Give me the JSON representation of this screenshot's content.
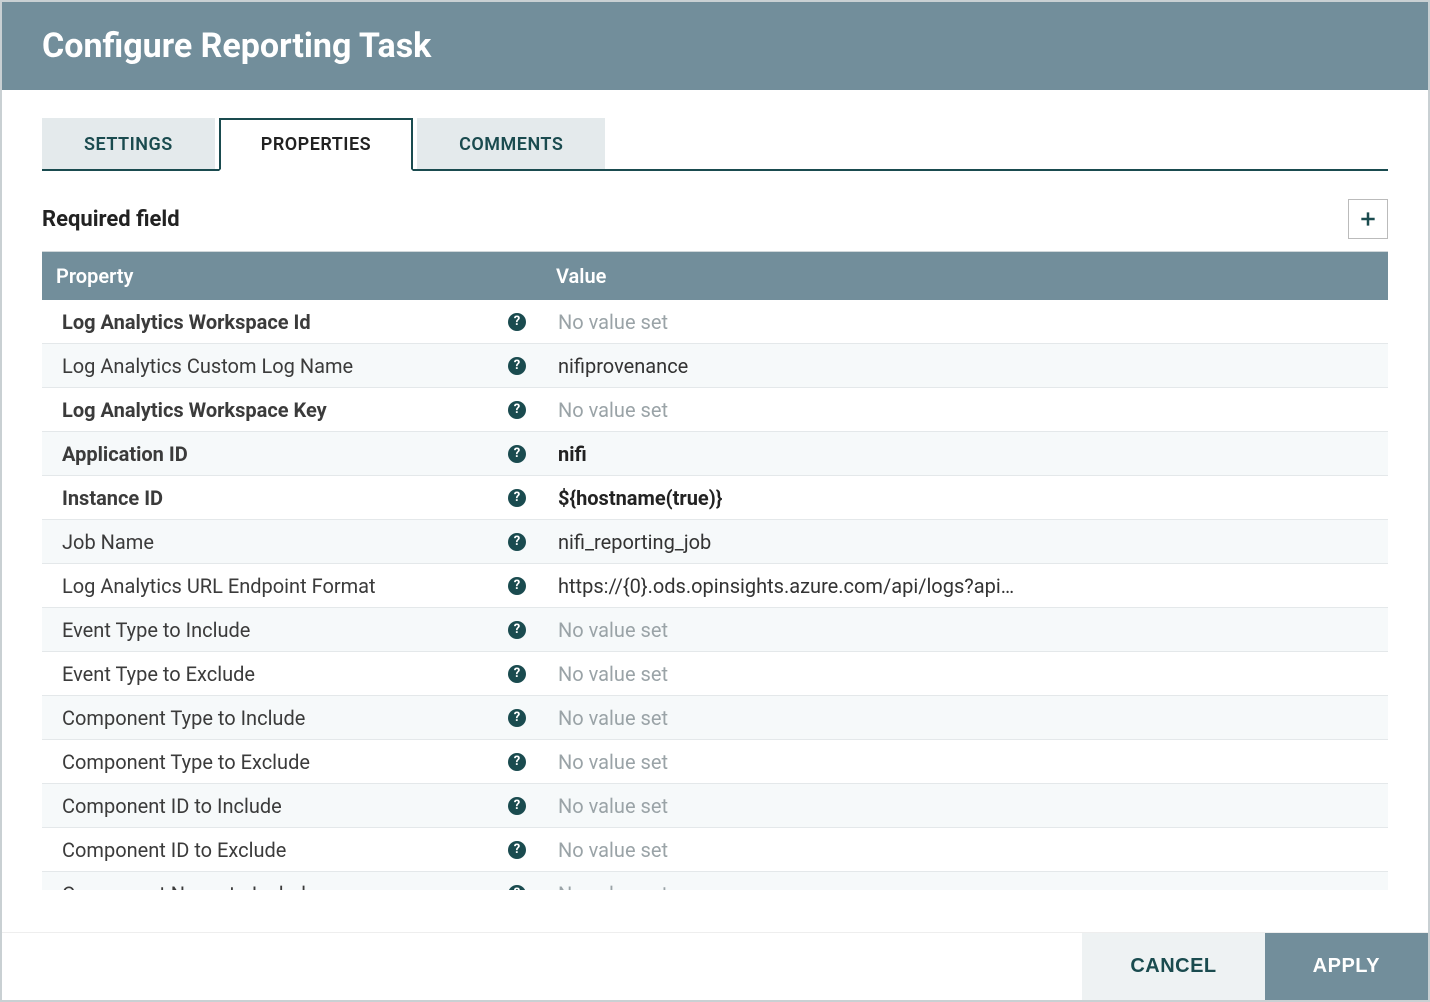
{
  "header": {
    "title": "Configure Reporting Task"
  },
  "tabs": [
    {
      "id": "settings",
      "label": "SETTINGS",
      "active": false
    },
    {
      "id": "properties",
      "label": "PROPERTIES",
      "active": true
    },
    {
      "id": "comments",
      "label": "COMMENTS",
      "active": false
    }
  ],
  "section": {
    "required_field_heading": "Required field"
  },
  "table": {
    "headers": {
      "property": "Property",
      "value": "Value"
    },
    "rows": [
      {
        "name": "Log Analytics Workspace Id",
        "required": true,
        "value": "",
        "placeholder": "No value set",
        "bold": false
      },
      {
        "name": "Log Analytics Custom Log Name",
        "required": false,
        "value": "nifiprovenance",
        "placeholder": "No value set",
        "bold": false
      },
      {
        "name": "Log Analytics Workspace Key",
        "required": true,
        "value": "",
        "placeholder": "No value set",
        "bold": false
      },
      {
        "name": "Application ID",
        "required": true,
        "value": "nifi",
        "placeholder": "No value set",
        "bold": true
      },
      {
        "name": "Instance ID",
        "required": true,
        "value": "${hostname(true)}",
        "placeholder": "No value set",
        "bold": true
      },
      {
        "name": "Job Name",
        "required": false,
        "value": "nifi_reporting_job",
        "placeholder": "No value set",
        "bold": false
      },
      {
        "name": "Log Analytics URL Endpoint Format",
        "required": false,
        "value": "https://{0}.ods.opinsights.azure.com/api/logs?api…",
        "placeholder": "No value set",
        "bold": false
      },
      {
        "name": "Event Type to Include",
        "required": false,
        "value": "",
        "placeholder": "No value set",
        "bold": false
      },
      {
        "name": "Event Type to Exclude",
        "required": false,
        "value": "",
        "placeholder": "No value set",
        "bold": false
      },
      {
        "name": "Component Type to Include",
        "required": false,
        "value": "",
        "placeholder": "No value set",
        "bold": false
      },
      {
        "name": "Component Type to Exclude",
        "required": false,
        "value": "",
        "placeholder": "No value set",
        "bold": false
      },
      {
        "name": "Component ID to Include",
        "required": false,
        "value": "",
        "placeholder": "No value set",
        "bold": false
      },
      {
        "name": "Component ID to Exclude",
        "required": false,
        "value": "",
        "placeholder": "No value set",
        "bold": false
      },
      {
        "name": "Component Name to Include",
        "required": false,
        "value": "",
        "placeholder": "No value set",
        "bold": false
      }
    ]
  },
  "footer": {
    "cancel_label": "CANCEL",
    "apply_label": "APPLY"
  },
  "icons": {
    "add": "plus-icon",
    "help": "?"
  }
}
